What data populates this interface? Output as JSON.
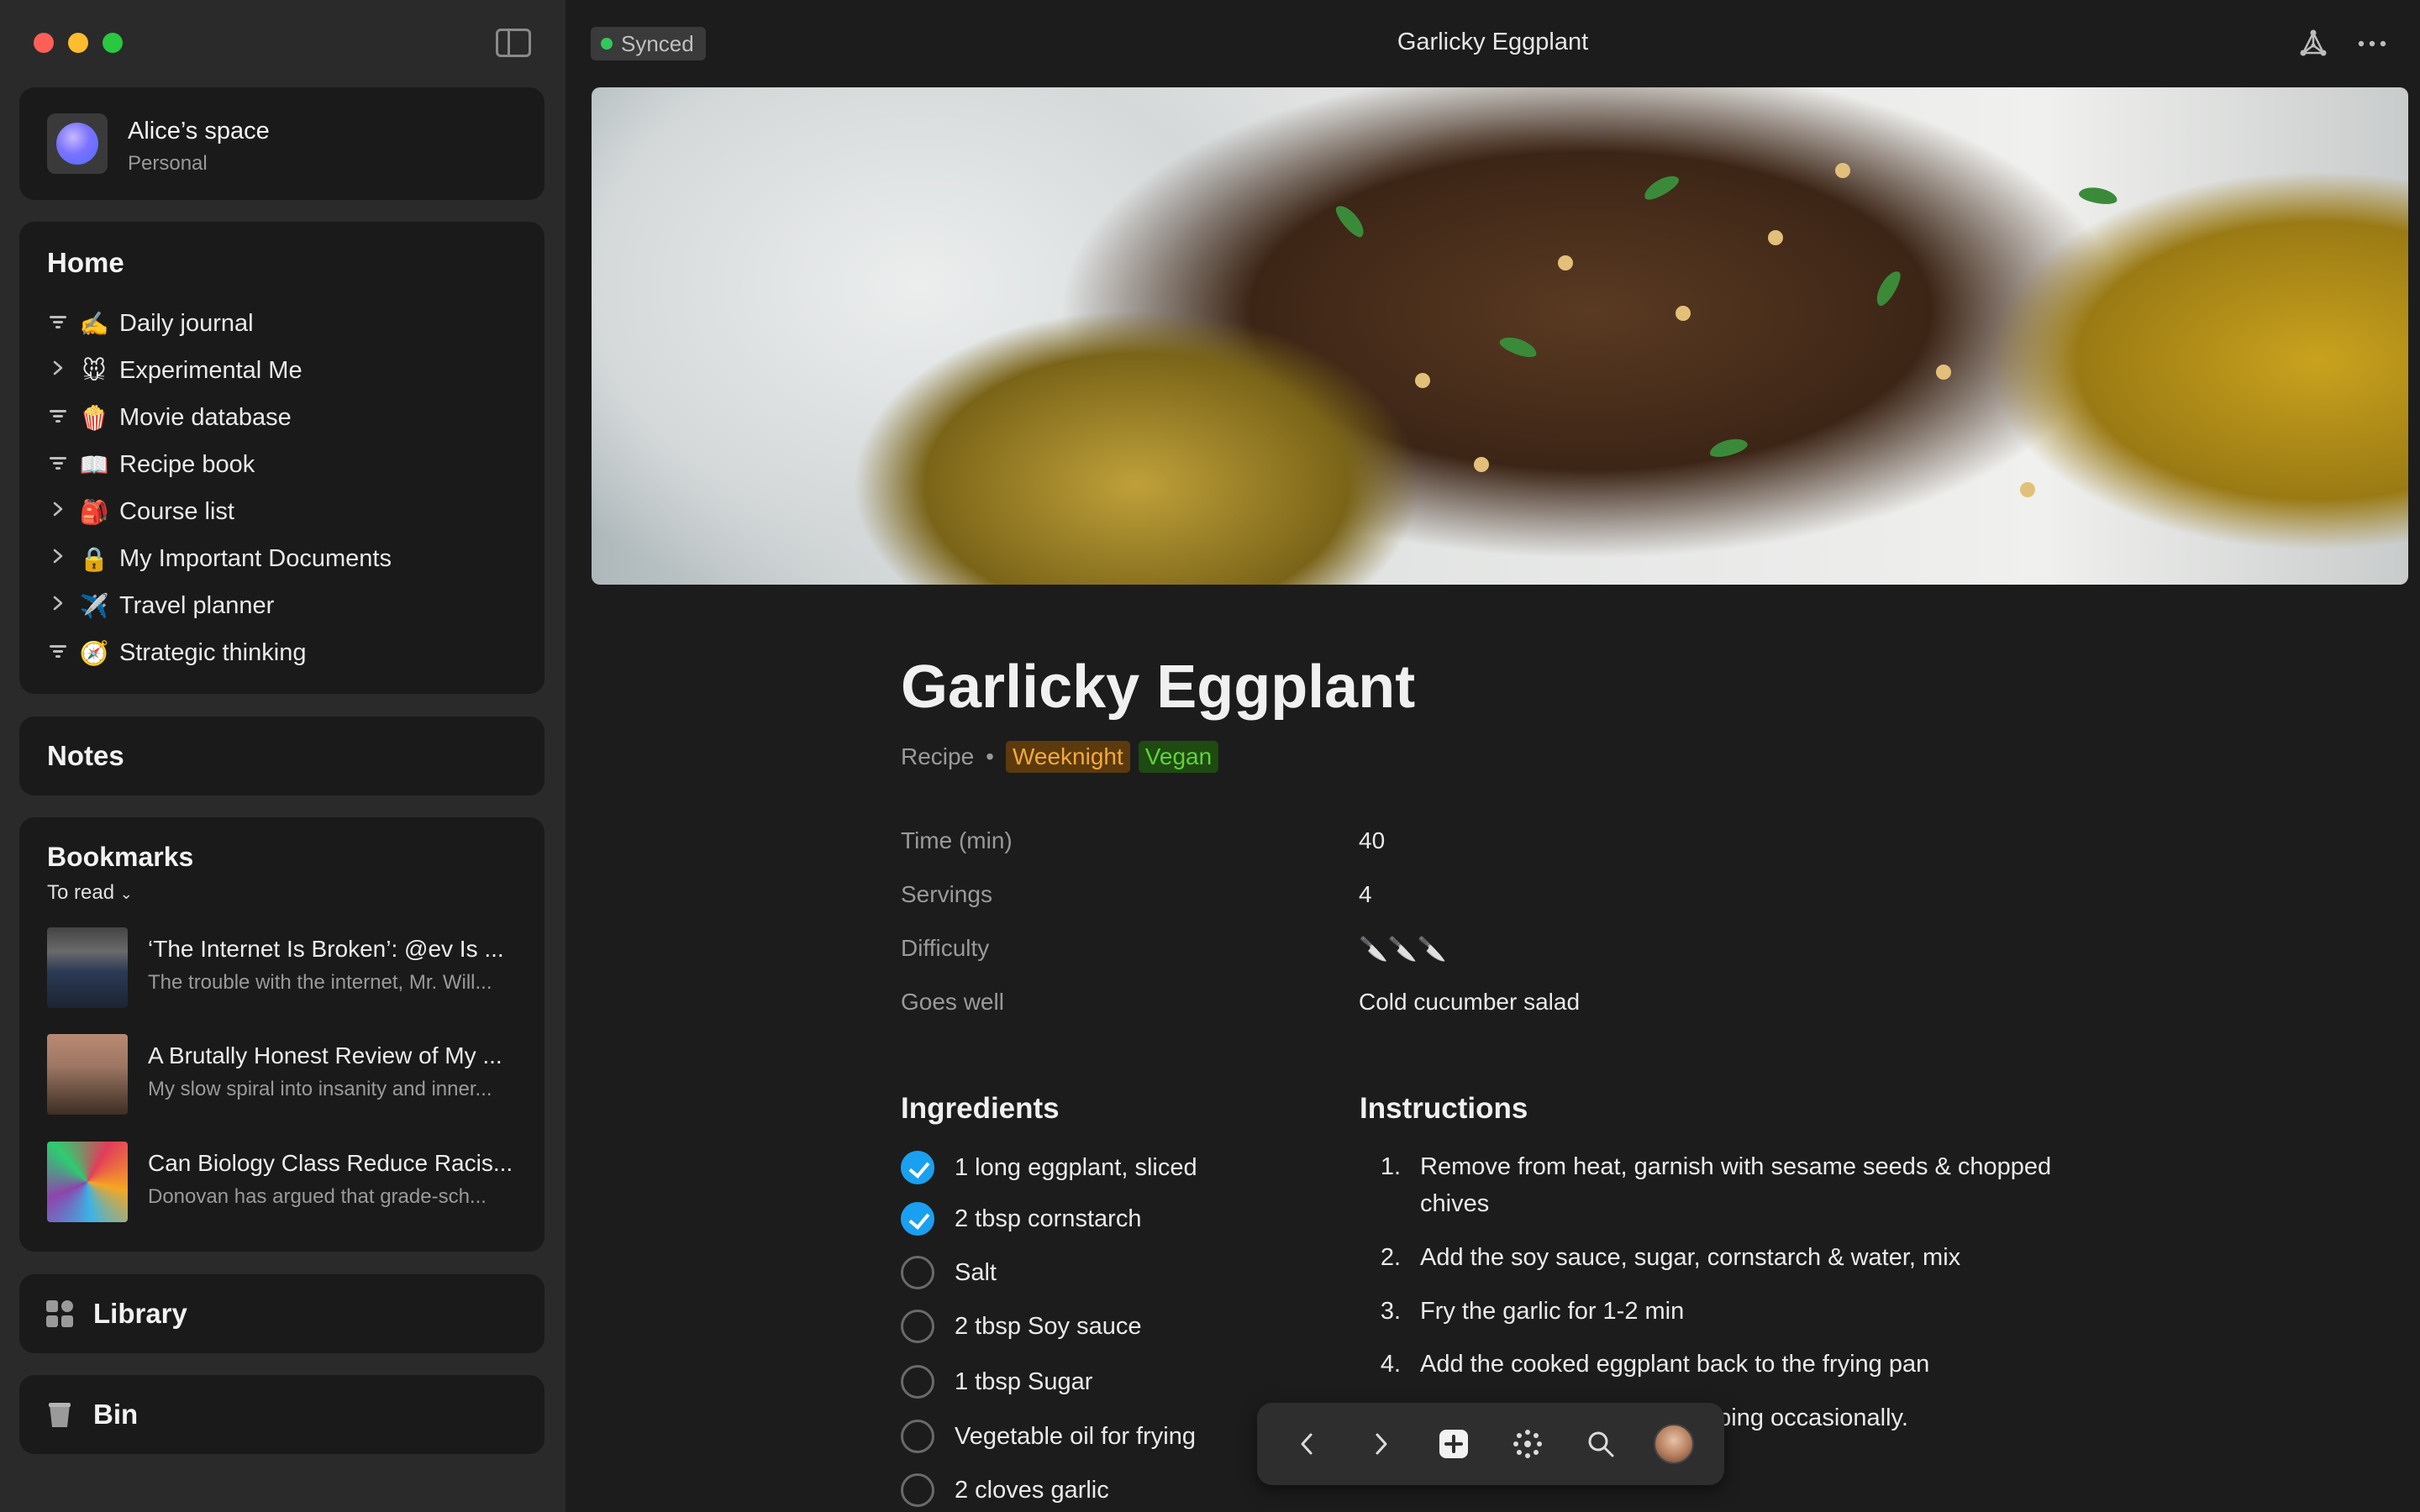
{
  "window": {
    "title": "Garlicky Eggplant"
  },
  "status": {
    "sync_label": "Synced"
  },
  "space": {
    "name": "Alice’s space",
    "subtitle": "Personal"
  },
  "home": {
    "title": "Home",
    "items": [
      {
        "lead": "filter",
        "emoji": "✍️",
        "label": "Daily journal"
      },
      {
        "lead": "chevron",
        "emoji": "🐭",
        "label": "Experimental Me"
      },
      {
        "lead": "filter",
        "emoji": "🍿",
        "label": "Movie database"
      },
      {
        "lead": "filter",
        "emoji": "📖",
        "label": "Recipe book"
      },
      {
        "lead": "chevron",
        "emoji": "🎒",
        "label": "Course list"
      },
      {
        "lead": "chevron",
        "emoji": "🔒",
        "label": "My Important Documents"
      },
      {
        "lead": "chevron",
        "emoji": "✈️",
        "label": "Travel planner"
      },
      {
        "lead": "filter",
        "emoji": "🧭",
        "label": "Strategic thinking"
      }
    ]
  },
  "notes": {
    "title": "Notes"
  },
  "bookmarks": {
    "title": "Bookmarks",
    "filter": "To read",
    "items": [
      {
        "title": "‘The Internet Is Broken’: @ev Is ...",
        "desc": "The trouble with the internet, Mr. Will..."
      },
      {
        "title": "A Brutally Honest Review of My ...",
        "desc": "My slow spiral into insanity and inner..."
      },
      {
        "title": "Can Biology Class Reduce Racis...",
        "desc": "Donovan has argued that grade-sch..."
      }
    ]
  },
  "library": {
    "label": "Library"
  },
  "bin": {
    "label": "Bin"
  },
  "page": {
    "title": "Garlicky Eggplant",
    "type": "Recipe",
    "tags": [
      "Weeknight",
      "Vegan"
    ],
    "properties": [
      {
        "name": "Time (min)",
        "value": "40"
      },
      {
        "name": "Servings",
        "value": "4"
      },
      {
        "name": "Difficulty",
        "value": "🔪🔪🔪"
      },
      {
        "name": "Goes well",
        "value": "Cold cucumber salad"
      }
    ],
    "ingredients_title": "Ingredients",
    "ingredients": [
      {
        "text": "1 long eggplant, sliced",
        "checked": true
      },
      {
        "text": "2 tbsp cornstarch",
        "checked": true
      },
      {
        "text": "Salt",
        "checked": false
      },
      {
        "text": "2 tbsp Soy sauce",
        "checked": false
      },
      {
        "text": "1 tbsp Sugar",
        "checked": false
      },
      {
        "text": "Vegetable oil for frying",
        "checked": false
      },
      {
        "text": "2 cloves garlic",
        "checked": false
      }
    ],
    "instructions_title": "Instructions",
    "instructions": [
      {
        "num": "1.",
        "text": "Remove from heat, garnish with sesame seeds & chopped chives"
      },
      {
        "num": "2.",
        "text": "Add the soy sauce, sugar, cornstarch & water, mix"
      },
      {
        "num": "3.",
        "text": "Fry the garlic for 1-2 min"
      },
      {
        "num": "4.",
        "text": "Add the cooked eggplant back to the frying pan"
      },
      {
        "num": "5.",
        "text": "brown, flipping occasionally."
      }
    ]
  },
  "colors": {
    "accent": "#1aa0f0",
    "sync_dot": "#33c85a",
    "tag_weeknight": "#f2a93b",
    "tag_vegan": "#5fd23c"
  }
}
